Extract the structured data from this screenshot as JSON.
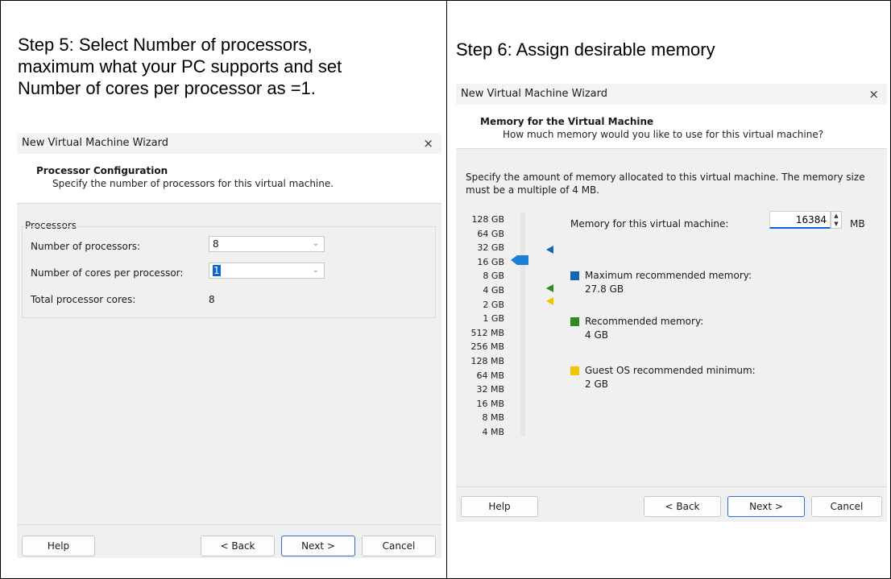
{
  "left_panel": {
    "step_title_line1": "Step 5: Select Number of processors,",
    "step_title_line2": "maximum what your PC supports and set",
    "step_title_line3": "Number of cores per processor as =1.",
    "dialog": {
      "title": "New Virtual Machine Wizard",
      "close_glyph": "×",
      "header_title": "Processor Configuration",
      "header_subtitle": "Specify the number of processors for this virtual machine.",
      "group_label": "Processors",
      "num_processors_label": "Number of processors:",
      "num_processors_value": "8",
      "cores_label": "Number of cores per processor:",
      "cores_value": "1",
      "total_label": "Total processor cores:",
      "total_value": "8",
      "help_button": "Help",
      "back_button": "< Back",
      "next_button": "Next >",
      "cancel_button": "Cancel",
      "combo_arrow": "⌄"
    }
  },
  "right_panel": {
    "step_title": "Step 6: Assign desirable memory",
    "dialog": {
      "title": "New Virtual Machine Wizard",
      "close_glyph": "×",
      "header_title": "Memory for the Virtual Machine",
      "header_subtitle": "How much memory would you like to use for this virtual machine?",
      "description_line1": "Specify the amount of memory allocated to this virtual machine. The memory size",
      "description_line2": "must be a multiple of 4 MB.",
      "memory_label": "Memory for this virtual machine:",
      "memory_value": "16384",
      "memory_unit": "MB",
      "scale_labels": [
        "128 GB",
        "64 GB",
        "32 GB",
        "16 GB",
        "8 GB",
        "4 GB",
        "2 GB",
        "1 GB",
        "512 MB",
        "256 MB",
        "128 MB",
        "64 MB",
        "32 MB",
        "16 MB",
        "8 MB",
        "4 MB"
      ],
      "legend_max_label": "Maximum recommended memory:",
      "legend_max_value": "27.8 GB",
      "legend_rec_label": "Recommended memory:",
      "legend_rec_value": "4 GB",
      "legend_min_label": "Guest OS recommended minimum:",
      "legend_min_value": "2 GB",
      "help_button": "Help",
      "back_button": "< Back",
      "next_button": "Next >",
      "cancel_button": "Cancel",
      "spin_up": "▲",
      "spin_down": "▼"
    },
    "colors": {
      "max": "#1464b4",
      "recommended": "#2e8b1e",
      "minimum": "#f2c500",
      "slider_thumb": "#1a7fd6"
    }
  }
}
